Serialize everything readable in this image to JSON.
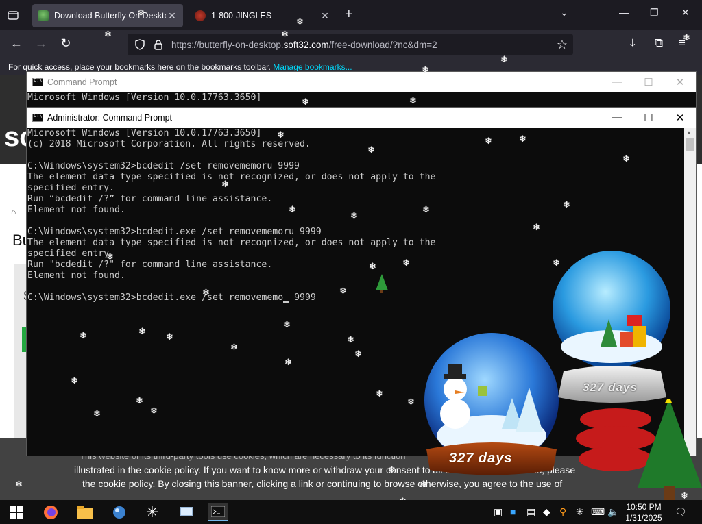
{
  "browser": {
    "tabs": [
      {
        "title": "Download Butterfly On Desktop",
        "active": true
      },
      {
        "title": "1-800-JINGLES",
        "active": false
      }
    ],
    "url_prefix": "https://butterfly-on-desktop.",
    "url_domain": "soft32.com",
    "url_suffix": "/free-download/?nc&dm=2",
    "bookmarks_text": "For quick access, place your bookmarks here on the bookmarks toolbar.",
    "bookmarks_link": "Manage bookmarks..."
  },
  "webpage": {
    "logo_text": "so",
    "heading_fragment": "Bu",
    "side_letter": "S",
    "cookie_line0": "This website or its third-party tools use cookies, which are necessary to its function",
    "cookie_line1": "illustrated in the cookie policy. If you want to know more or withdraw your consent to all or some of the cookies, please",
    "cookie_line2_pre": "the ",
    "cookie_link": "cookie policy",
    "cookie_line2_post": ". By closing this banner, clicking a link or continuing to browse otherwise, you agree to the use of"
  },
  "cmd_back": {
    "title": "Command Prompt",
    "lines": [
      "Microsoft Windows [Version 10.0.17763.3650]"
    ]
  },
  "cmd_front": {
    "title": "Administrator: Command Prompt",
    "lines": [
      "Microsoft Windows [Version 10.0.17763.3650]",
      "(c) 2018 Microsoft Corporation. All rights reserved.",
      "",
      "C:\\Windows\\system32>bcdedit /set removememoru 9999",
      "The element data type specified is not recognized, or does not apply to the",
      "specified entry.",
      "Run “bcdedit /?” for command line assistance.",
      "Element not found.",
      "",
      "C:\\Windows\\system32>bcdedit.exe /set removememoru 9999",
      "The element data type specified is not recognized, or does not apply to the",
      "specified entry.",
      "Run \"bcdedit /?\" for command line assistance.",
      "Element not found.",
      ""
    ],
    "prompt_before_cursor": "C:\\Windows\\system32>bcdedit.exe /set removememo",
    "prompt_after_cursor": " 9999"
  },
  "desktop": {
    "globe_small_days": "327 days",
    "globe_big_days": "327 days"
  },
  "taskbar": {
    "time": "10:50 PM",
    "date": "1/31/2025",
    "apps": [
      "start-icon",
      "firefox-icon",
      "file-explorer-icon",
      "app-icon",
      "snowflake-icon",
      "control-panel-icon",
      "command-prompt-icon"
    ]
  }
}
